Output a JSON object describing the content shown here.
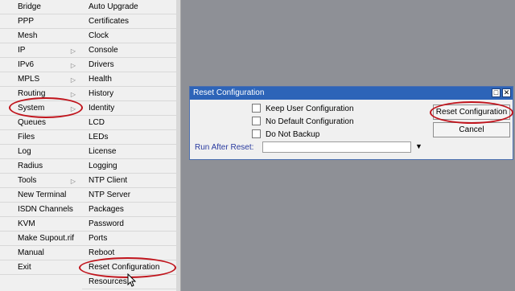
{
  "main_menu": {
    "items": [
      {
        "label": "Bridge",
        "submenu": false
      },
      {
        "label": "PPP",
        "submenu": false
      },
      {
        "label": "Mesh",
        "submenu": false
      },
      {
        "label": "IP",
        "submenu": true
      },
      {
        "label": "IPv6",
        "submenu": true
      },
      {
        "label": "MPLS",
        "submenu": true
      },
      {
        "label": "Routing",
        "submenu": true
      },
      {
        "label": "System",
        "submenu": true
      },
      {
        "label": "Queues",
        "submenu": false
      },
      {
        "label": "Files",
        "submenu": false
      },
      {
        "label": "Log",
        "submenu": false
      },
      {
        "label": "Radius",
        "submenu": false
      },
      {
        "label": "Tools",
        "submenu": true
      },
      {
        "label": "New Terminal",
        "submenu": false
      },
      {
        "label": "ISDN Channels",
        "submenu": false
      },
      {
        "label": "KVM",
        "submenu": false
      },
      {
        "label": "Make Supout.rif",
        "submenu": false
      },
      {
        "label": "Manual",
        "submenu": false
      },
      {
        "label": "Exit",
        "submenu": false
      }
    ]
  },
  "sub_menu": {
    "items": [
      "Auto Upgrade",
      "Certificates",
      "Clock",
      "Console",
      "Drivers",
      "Health",
      "History",
      "Identity",
      "LCD",
      "LEDs",
      "License",
      "Logging",
      "NTP Client",
      "NTP Server",
      "Packages",
      "Password",
      "Ports",
      "Reboot",
      "Reset Configuration",
      "Resources"
    ]
  },
  "dialog": {
    "title": "Reset Configuration",
    "checkboxes": [
      {
        "label": "Keep User Configuration",
        "checked": false
      },
      {
        "label": "No Default Configuration",
        "checked": false
      },
      {
        "label": "Do Not Backup",
        "checked": false
      }
    ],
    "run_after_reset_label": "Run After Reset:",
    "run_after_reset_value": "",
    "reset_button": "Reset Configuration",
    "cancel_button": "Cancel",
    "restore_glyph": "□",
    "close_glyph": "✕"
  },
  "colors": {
    "titlebar": "#2d64b8",
    "highlight_ring": "#c0141c",
    "desktop": "#8e9096"
  }
}
